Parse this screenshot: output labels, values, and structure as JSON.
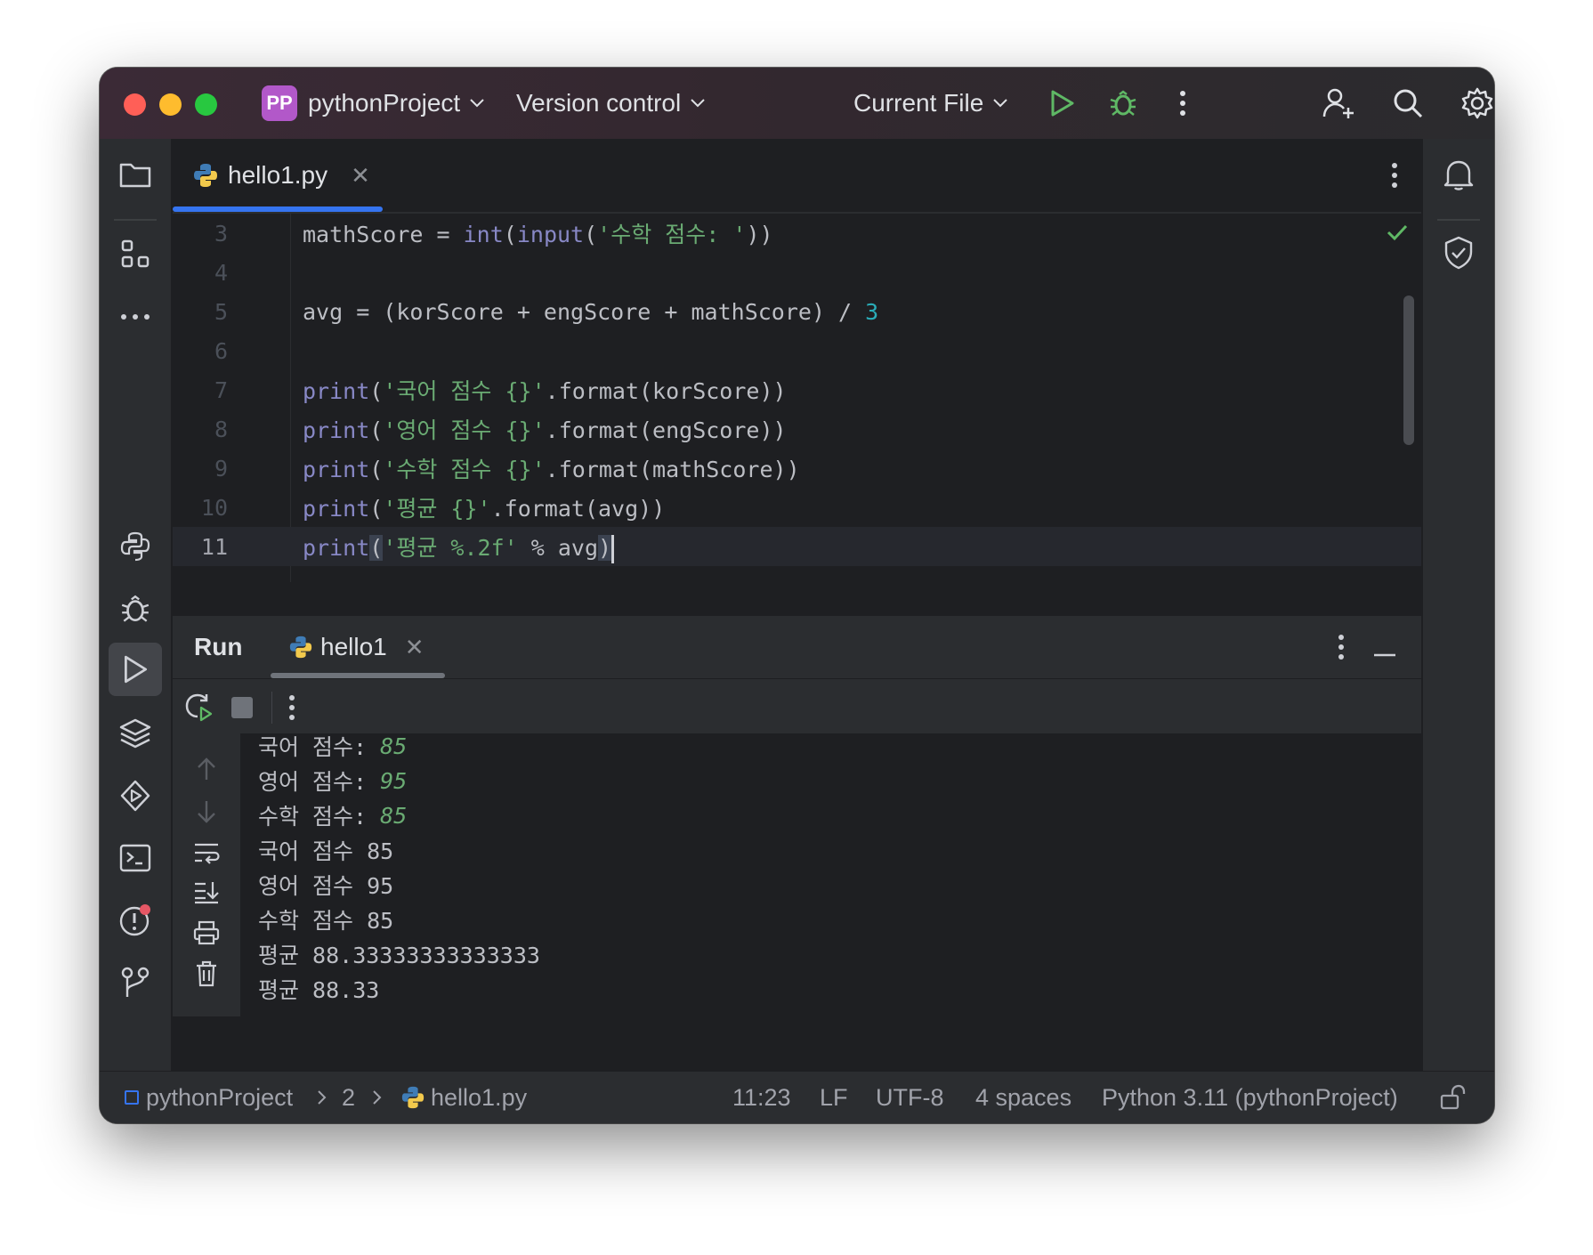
{
  "titlebar": {
    "project_badge": "PP",
    "project_name": "pythonProject",
    "vcs_label": "Version control",
    "run_config": "Current File"
  },
  "editor": {
    "tab_label": "hello1.py",
    "lines": [
      {
        "num": "3",
        "text": "mathScore = int(input('수학 점수: '))"
      },
      {
        "num": "4",
        "text": ""
      },
      {
        "num": "5",
        "text": "avg = (korScore + engScore + mathScore) / 3"
      },
      {
        "num": "6",
        "text": ""
      },
      {
        "num": "7",
        "text": "print('국어 점수 {}'.format(korScore))"
      },
      {
        "num": "8",
        "text": "print('영어 점수 {}'.format(engScore))"
      },
      {
        "num": "9",
        "text": "print('수학 점수 {}'.format(mathScore))"
      },
      {
        "num": "10",
        "text": "print('평균 {}'.format(avg))"
      },
      {
        "num": "11",
        "text": "print('평균 %.2f' % avg)"
      }
    ]
  },
  "run": {
    "title": "Run",
    "tab_label": "hello1",
    "output": [
      {
        "prompt": "국어 점수: ",
        "input": "85"
      },
      {
        "prompt": "영어 점수: ",
        "input": "95"
      },
      {
        "prompt": "수학 점수: ",
        "input": "85"
      },
      {
        "prompt": "국어 점수 85",
        "input": ""
      },
      {
        "prompt": "영어 점수 95",
        "input": ""
      },
      {
        "prompt": "수학 점수 85",
        "input": ""
      },
      {
        "prompt": "평균 88.33333333333333",
        "input": ""
      },
      {
        "prompt": "평균 88.33",
        "input": ""
      }
    ]
  },
  "statusbar": {
    "project": "pythonProject",
    "folder": "2",
    "file": "hello1.py",
    "position": "11:23",
    "line_ending": "LF",
    "encoding": "UTF-8",
    "indent": "4 spaces",
    "interpreter": "Python 3.11 (pythonProject)"
  },
  "colors": {
    "accent": "#3574f0",
    "run_green": "#5fb865",
    "string_green": "#6aab73",
    "builtin_purple": "#8888c6",
    "number_cyan": "#2aacb8",
    "project_badge": "#b258c9"
  }
}
